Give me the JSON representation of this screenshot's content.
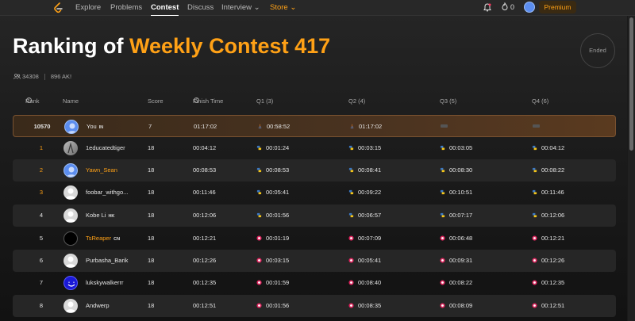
{
  "nav": {
    "items": [
      "Explore",
      "Problems",
      "Contest",
      "Discuss",
      "Interview",
      "Store"
    ],
    "active": "Contest",
    "streak": "0",
    "premium_label": "Premium"
  },
  "header": {
    "title_prefix": "Ranking of ",
    "title_accent": "Weekly Contest 417",
    "status": "Ended",
    "participants": "34308",
    "ak_count": "896 AK!"
  },
  "table": {
    "columns": [
      "Rank",
      "Name",
      "Score",
      "Finish Time",
      "Q1 (3)",
      "Q2 (4)",
      "Q3 (5)",
      "Q4 (6)"
    ],
    "rows": [
      {
        "rank": "10570",
        "name": "You",
        "flag": "IN",
        "score": "7",
        "finish": "01:17:02",
        "q1": "00:58:52",
        "q2": "01:17:02",
        "q3": "",
        "q4": "",
        "self": true,
        "lang": "up",
        "avatar": "blue"
      },
      {
        "rank": "1",
        "name": "1educatedtiger",
        "flag": "",
        "score": "18",
        "finish": "00:04:12",
        "q1": "00:01:24",
        "q2": "00:03:15",
        "q3": "00:03:05",
        "q4": "00:04:12",
        "lang": "py",
        "avatar": "photo"
      },
      {
        "rank": "2",
        "name": "Yawn_Sean",
        "flag": "",
        "score": "18",
        "finish": "00:08:53",
        "q1": "00:08:53",
        "q2": "00:08:41",
        "q3": "00:08:30",
        "q4": "00:08:22",
        "lang": "py",
        "avatar": "blue",
        "orange": true
      },
      {
        "rank": "3",
        "name": "foobar_withgo...",
        "flag": "",
        "score": "18",
        "finish": "00:11:46",
        "q1": "00:05:41",
        "q2": "00:09:22",
        "q3": "00:10:51",
        "q4": "00:11:46",
        "lang": "py",
        "avatar": "grey"
      },
      {
        "rank": "4",
        "name": "Kobe Li",
        "flag": "HK",
        "score": "18",
        "finish": "00:12:06",
        "q1": "00:01:56",
        "q2": "00:06:57",
        "q3": "00:07:17",
        "q4": "00:12:06",
        "lang": "py",
        "avatar": "grey"
      },
      {
        "rank": "5",
        "name": "TsReaper",
        "flag": "CN",
        "score": "18",
        "finish": "00:12:21",
        "q1": "00:01:19",
        "q2": "00:07:09",
        "q3": "00:06:48",
        "q4": "00:12:21",
        "lang": "cpp",
        "avatar": "black",
        "orange": true
      },
      {
        "rank": "6",
        "name": "Purbasha_Barik",
        "flag": "",
        "score": "18",
        "finish": "00:12:26",
        "q1": "00:03:15",
        "q2": "00:05:41",
        "q3": "00:09:31",
        "q4": "00:12:26",
        "lang": "cpp",
        "avatar": "grey"
      },
      {
        "rank": "7",
        "name": "lukskywalkerrr",
        "flag": "",
        "score": "18",
        "finish": "00:12:35",
        "q1": "00:01:59",
        "q2": "00:08:40",
        "q3": "00:08:22",
        "q4": "00:12:35",
        "lang": "cpp",
        "avatar": "smile"
      },
      {
        "rank": "8",
        "name": "Andwerp",
        "flag": "",
        "score": "18",
        "finish": "00:12:51",
        "q1": "00:01:56",
        "q2": "00:08:35",
        "q3": "00:08:09",
        "q4": "00:12:51",
        "lang": "cpp",
        "avatar": "grey"
      }
    ]
  },
  "colors": {
    "accent": "#ffa116",
    "self_row": "#4a3320"
  }
}
